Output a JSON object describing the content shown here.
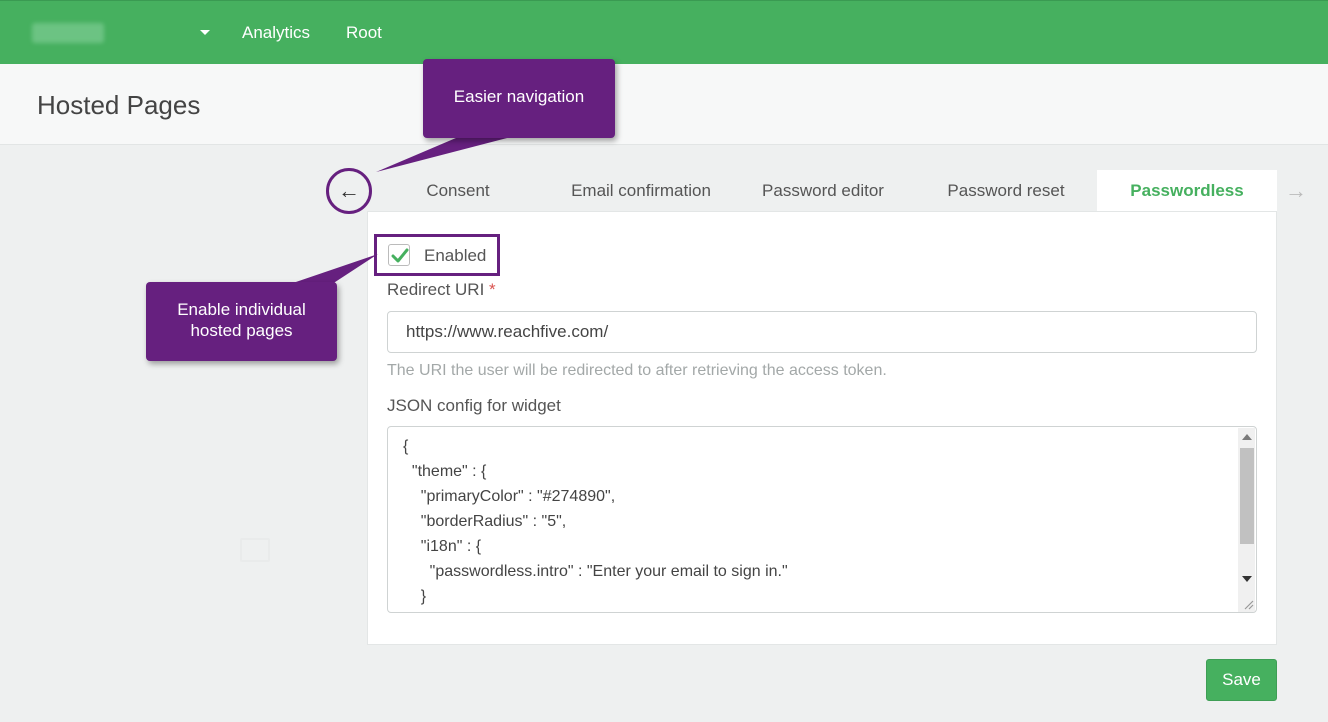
{
  "navbar": {
    "links": [
      "Analytics",
      "Root"
    ],
    "color": "#46b05f"
  },
  "page": {
    "title": "Hosted Pages"
  },
  "tabs": {
    "items": [
      "Consent",
      "Email confirmation",
      "Password editor",
      "Password reset",
      "Passwordless"
    ],
    "active": "Passwordless",
    "prev_icon": "arrow-left-icon",
    "next_icon": "arrow-right-icon"
  },
  "form": {
    "enabled_label": "Enabled",
    "enabled_checked": true,
    "redirect_label": "Redirect URI",
    "required_marker": "*",
    "redirect_value": "https://www.reachfive.com/",
    "redirect_help": "The URI the user will be redirected to after retrieving the access token.",
    "json_label": "JSON config for widget",
    "json_lines": [
      "{",
      "  \"theme\" : {",
      "    \"primaryColor\" : \"#274890\",",
      "    \"borderRadius\" : \"5\",",
      "    \"i18n\" : {",
      "      \"passwordless.intro\" : \"Enter your email to sign in.\"",
      "    }"
    ],
    "save_label": "Save"
  },
  "callouts": {
    "navigation": "Easier navigation",
    "enable_line1": "Enable individual",
    "enable_line2": "hosted pages",
    "color": "#66207f"
  }
}
